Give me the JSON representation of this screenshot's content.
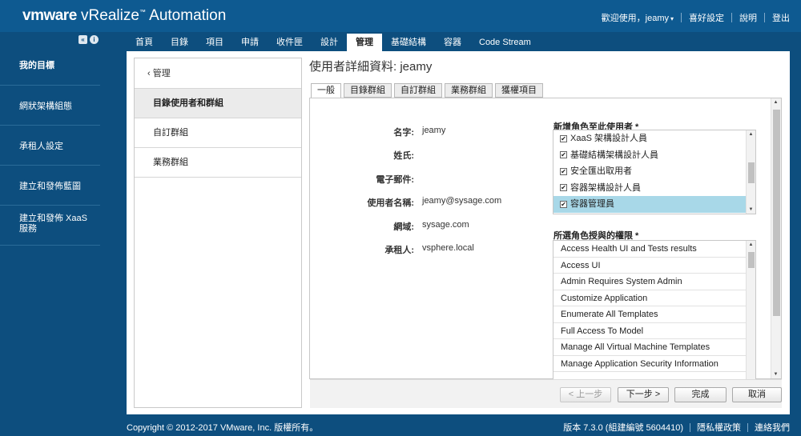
{
  "header": {
    "brand_vm": "vmware",
    "brand_product": " vRealize",
    "brand_tm": "™",
    "brand_suffix": " Automation",
    "welcome": "歡迎使用，jeamy",
    "preferences": "喜好設定",
    "help": "說明",
    "logout": "登出"
  },
  "sidebar": {
    "items": [
      {
        "label": "我的目標"
      },
      {
        "label": "網狀架構組態"
      },
      {
        "label": "承租人設定"
      },
      {
        "label": "建立和發佈藍圖"
      },
      {
        "label": "建立和發佈 XaaS 服務"
      }
    ]
  },
  "nav": {
    "tabs": [
      "首頁",
      "目錄",
      "項目",
      "申請",
      "收件匣",
      "設計",
      "管理",
      "基礎結構",
      "容器",
      "Code Stream"
    ],
    "active_index": 6
  },
  "subnav": {
    "back": "管理",
    "items": [
      "目錄使用者和群組",
      "自訂群組",
      "業務群組"
    ]
  },
  "page": {
    "title": "使用者詳細資料: jeamy"
  },
  "tabs": [
    "一般",
    "目錄群組",
    "自訂群組",
    "業務群組",
    "獲權項目"
  ],
  "form": {
    "fields": [
      {
        "label": "名字:",
        "value": "jeamy"
      },
      {
        "label": "姓氏:",
        "value": ""
      },
      {
        "label": "電子郵件:",
        "value": ""
      },
      {
        "label": "使用者名稱:",
        "value": "jeamy@sysage.com"
      },
      {
        "label": "網域:",
        "value": "sysage.com"
      },
      {
        "label": "承租人:",
        "value": "vsphere.local"
      }
    ]
  },
  "roles": {
    "title": "新增角色至此使用者",
    "items": [
      {
        "label": "XaaS 架構設計人員",
        "checked": true
      },
      {
        "label": "基礎結構架構設計人員",
        "checked": true
      },
      {
        "label": "安全匯出取用者",
        "checked": true
      },
      {
        "label": "容器架構設計人員",
        "checked": true
      },
      {
        "label": "容器管理員",
        "checked": true,
        "selected": true
      }
    ]
  },
  "permissions": {
    "title": "所選角色授與的權限",
    "items": [
      "Access Health UI and Tests results",
      "Access UI",
      "Admin Requires System Admin",
      "Customize Application",
      "Enumerate All Templates",
      "Full Access To Model",
      "Manage All Virtual Machine Templates",
      "Manage Application Security Information"
    ]
  },
  "buttons": {
    "prev": "< 上一步",
    "next": "下一步 >",
    "finish": "完成",
    "cancel": "取消"
  },
  "footer": {
    "copyright": "Copyright © 2012-2017 VMware, Inc. 版權所有。",
    "version": "版本 7.3.0 (組建編號 5604410)",
    "privacy": "隱私權政策",
    "contact": "連絡我們"
  },
  "icons": {
    "collapse": "double-chevron-left-icon",
    "info": "info-icon",
    "check": "✔"
  }
}
